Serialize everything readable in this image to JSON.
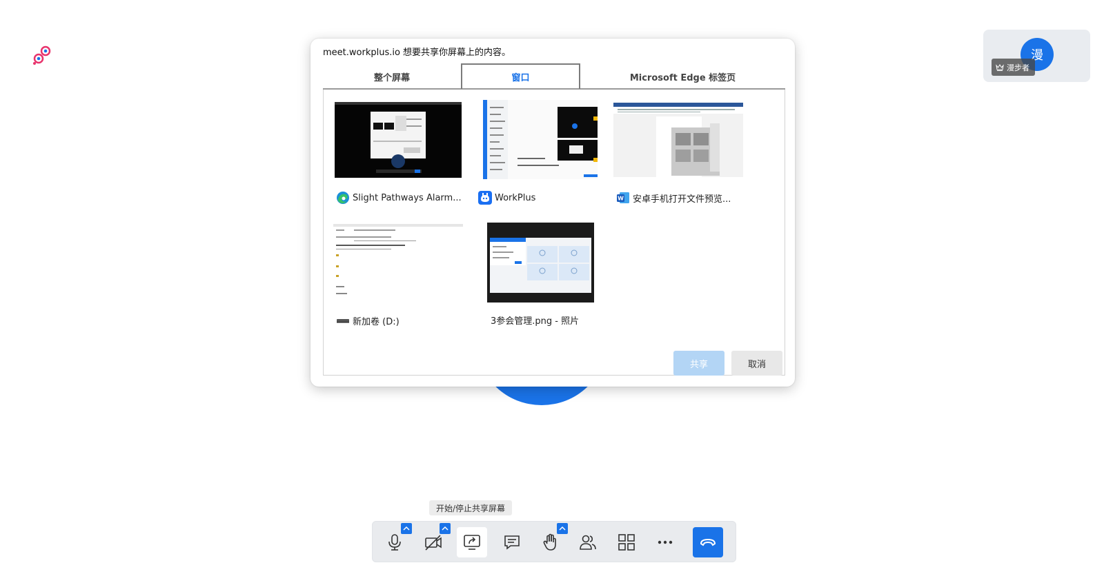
{
  "colors": {
    "accent": "#1a73e8",
    "share_disabled": "#b3d5f5"
  },
  "participant": {
    "avatar_char": "漫",
    "name": "漫步者"
  },
  "dialog": {
    "title": "meet.workplus.io 想要共享你屏幕上的内容。",
    "tabs": [
      {
        "label": "整个屏幕",
        "selected": false
      },
      {
        "label": "窗口",
        "selected": true
      },
      {
        "label": "Microsoft Edge 标签页",
        "selected": false
      }
    ],
    "windows": [
      {
        "label": "Slight Pathways Alarm...",
        "icon": "edge-icon"
      },
      {
        "label": "WorkPlus",
        "icon": "workplus-icon"
      },
      {
        "label": "安卓手机打开文件预览...",
        "icon": "word-icon"
      },
      {
        "label": "新加卷 (D:)",
        "icon": "drive-icon"
      },
      {
        "label": "3参会管理.png - 照片",
        "icon": "none"
      }
    ],
    "share_label": "共享",
    "cancel_label": "取消"
  },
  "tooltip": "开始/停止共享屏幕",
  "toolbar": {
    "items": [
      {
        "name": "microphone",
        "icon": "microphone-icon",
        "has_caret": true
      },
      {
        "name": "camera",
        "icon": "camera-off-icon",
        "has_caret": true
      },
      {
        "name": "share-screen",
        "icon": "share-screen-icon",
        "has_caret": false,
        "active": true
      },
      {
        "name": "chat",
        "icon": "chat-icon",
        "has_caret": false
      },
      {
        "name": "raise-hand",
        "icon": "hand-icon",
        "has_caret": true
      },
      {
        "name": "participants",
        "icon": "participants-icon",
        "has_caret": false
      },
      {
        "name": "layout",
        "icon": "grid-icon",
        "has_caret": false
      },
      {
        "name": "more",
        "icon": "more-icon",
        "has_caret": false
      },
      {
        "name": "hang-up",
        "icon": "hang-up-icon",
        "has_caret": false
      }
    ]
  }
}
